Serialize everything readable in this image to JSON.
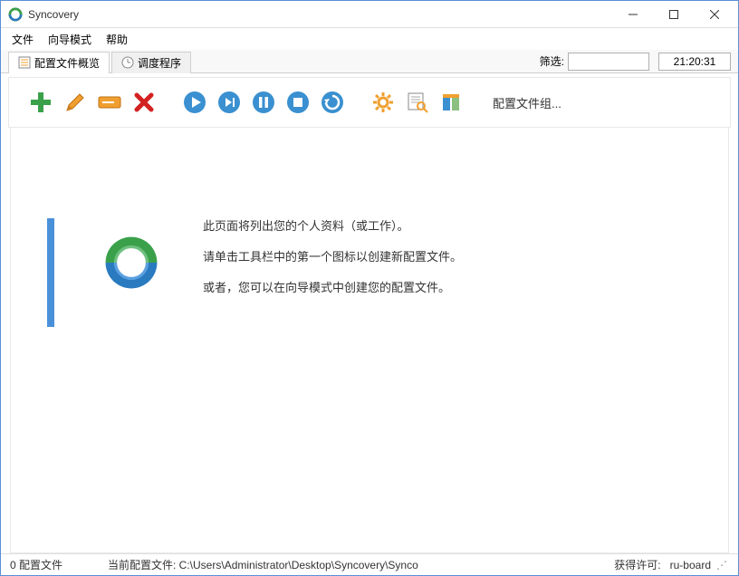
{
  "title": "Syncovery",
  "menu": {
    "file": "文件",
    "wizard": "向导模式",
    "help": "帮助"
  },
  "tabs": {
    "overview": "配置文件概览",
    "scheduler": "调度程序"
  },
  "filter": {
    "label": "筛选:",
    "value": ""
  },
  "clock": "21:20:31",
  "toolbar": {
    "group_label": "配置文件组..."
  },
  "message": {
    "line1": "此页面将列出您的个人资料（或工作）。",
    "line2": "请单击工具栏中的第一个图标以创建新配置文件。",
    "line3": "或者，您可以在向导模式中创建您的配置文件。"
  },
  "status": {
    "count": "0 配置文件",
    "path_label": "当前配置文件: C:\\Users\\Administrator\\Desktop\\Syncovery\\Synco",
    "license_label": "获得许可:",
    "license_user": "ru-board"
  }
}
